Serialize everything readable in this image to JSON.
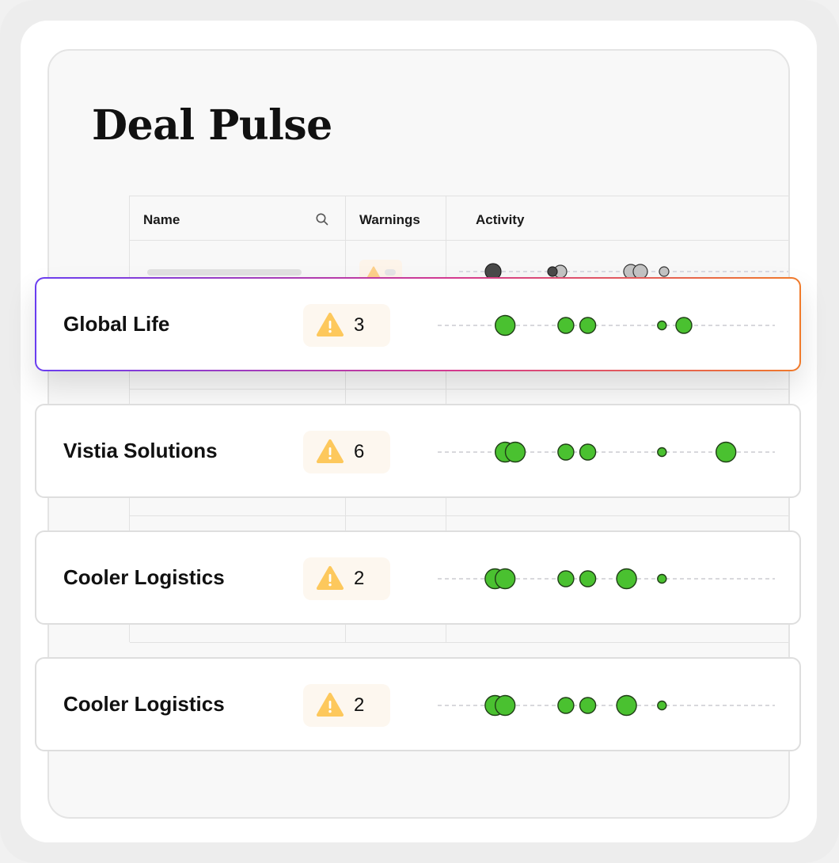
{
  "page": {
    "title": "Deal Pulse"
  },
  "table": {
    "columns": [
      {
        "label": "Name"
      },
      {
        "label": "Warnings"
      },
      {
        "label": "Activity"
      }
    ]
  },
  "deals": [
    {
      "name": "Global Life",
      "warnings": "3",
      "highlighted": true,
      "activity": [
        {
          "x": 0.2,
          "s": "l"
        },
        {
          "x": 0.38,
          "s": "m"
        },
        {
          "x": 0.445,
          "s": "m"
        },
        {
          "x": 0.665,
          "s": "s"
        },
        {
          "x": 0.73,
          "s": "m"
        }
      ]
    },
    {
      "name": "Vistia Solutions",
      "warnings": "6",
      "highlighted": false,
      "activity": [
        {
          "x": 0.2,
          "s": "l"
        },
        {
          "x": 0.23,
          "s": "l"
        },
        {
          "x": 0.38,
          "s": "m"
        },
        {
          "x": 0.445,
          "s": "m"
        },
        {
          "x": 0.665,
          "s": "s"
        },
        {
          "x": 0.855,
          "s": "l"
        }
      ]
    },
    {
      "name": "Cooler Logistics",
      "warnings": "2",
      "highlighted": false,
      "activity": [
        {
          "x": 0.17,
          "s": "l"
        },
        {
          "x": 0.2,
          "s": "l"
        },
        {
          "x": 0.38,
          "s": "m"
        },
        {
          "x": 0.445,
          "s": "m"
        },
        {
          "x": 0.56,
          "s": "l"
        },
        {
          "x": 0.665,
          "s": "s"
        }
      ]
    },
    {
      "name": "Cooler Logistics",
      "warnings": "2",
      "highlighted": false,
      "activity": [
        {
          "x": 0.17,
          "s": "l"
        },
        {
          "x": 0.2,
          "s": "l"
        },
        {
          "x": 0.38,
          "s": "m"
        },
        {
          "x": 0.445,
          "s": "m"
        },
        {
          "x": 0.56,
          "s": "l"
        },
        {
          "x": 0.665,
          "s": "s"
        }
      ]
    }
  ],
  "colors": {
    "activity_dot": "#4ac130",
    "warning_icon": "#fdc85c",
    "dot_dark": "#4a4a4a",
    "dot_light": "#c4c4c4"
  }
}
